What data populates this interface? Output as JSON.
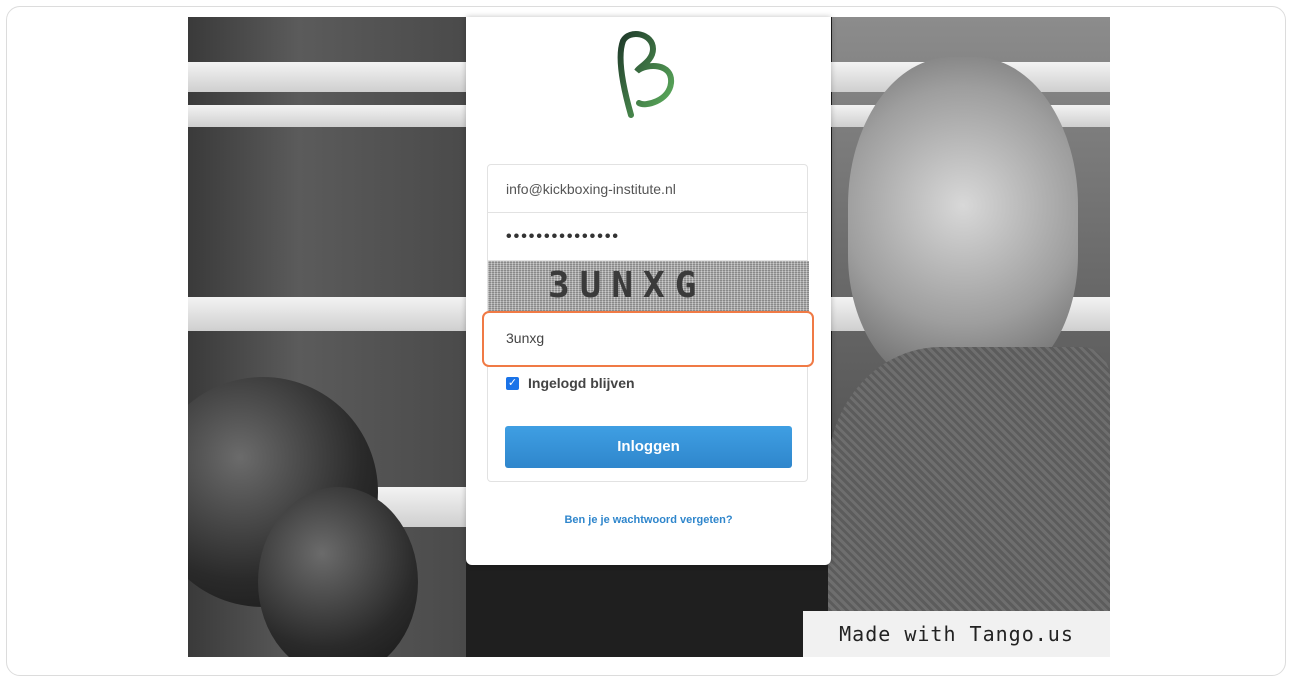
{
  "login": {
    "email_value": "info@kickboxing-institute.nl",
    "password_value": "•••••••••••••••",
    "captcha_text": "3UNXG",
    "captcha_input_value": "3unxg",
    "remember_label": "Ingelogd blijven",
    "remember_checked": true,
    "login_button": "Inloggen",
    "forgot_link": "Ben je je wachtwoord vergeten?"
  },
  "watermark": "Made with Tango.us",
  "colors": {
    "accent_orange": "#f07a45",
    "button_blue": "#2f86cc",
    "logo_green": "#2e7d32"
  },
  "icons": {
    "logo": "brand-b-logo-icon",
    "checkbox": "checkmark-icon"
  }
}
